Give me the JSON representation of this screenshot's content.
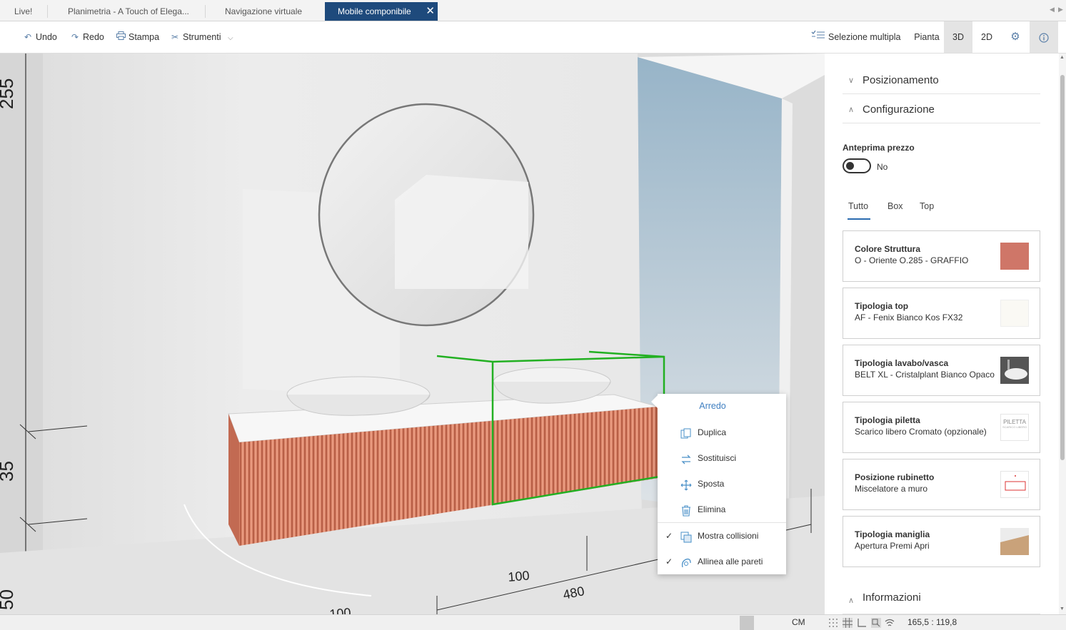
{
  "tabs": [
    {
      "label": "Live!",
      "active": false
    },
    {
      "label": "Planimetria - A Touch of Elega...",
      "active": false
    },
    {
      "label": "Navigazione virtuale",
      "active": false
    },
    {
      "label": "Mobile componibile",
      "active": true
    }
  ],
  "tab_close_glyph": "✕",
  "toolbar": {
    "undo": "Undo",
    "redo": "Redo",
    "print": "Stampa",
    "tools": "Strumenti",
    "multi_select": "Selezione multipla",
    "plan": "Pianta",
    "view3d": "3D",
    "view2d": "2D"
  },
  "viewport": {
    "dimension_labels": [
      "255",
      "35",
      "50",
      "100",
      "480",
      "100"
    ]
  },
  "context_menu": {
    "title": "Arredo",
    "items": [
      {
        "label": "Duplica",
        "icon": "duplicate-icon",
        "checked": false
      },
      {
        "label": "Sostituisci",
        "icon": "swap-icon",
        "checked": false
      },
      {
        "label": "Sposta",
        "icon": "move-icon",
        "checked": false
      },
      {
        "label": "Elimina",
        "icon": "trash-icon",
        "checked": false
      },
      {
        "label": "Mostra collisioni",
        "icon": "collision-icon",
        "checked": true
      },
      {
        "label": "Allinea alle pareti",
        "icon": "align-walls-icon",
        "checked": true
      }
    ],
    "check_glyph": "✓"
  },
  "panel": {
    "sections": {
      "positioning": "Posizionamento",
      "configuration": "Configurazione",
      "information": "Informazioni"
    },
    "price_preview": {
      "label": "Anteprima prezzo",
      "value": "No",
      "enabled": false
    },
    "subtabs": [
      {
        "label": "Tutto",
        "active": true
      },
      {
        "label": "Box",
        "active": false
      },
      {
        "label": "Top",
        "active": false
      }
    ],
    "cards": [
      {
        "title": "Colore Struttura",
        "value": "O - Oriente O.285 - GRAFFIO",
        "swatch": "#cf7668"
      },
      {
        "title": "Tipologia top",
        "value": "AF - Fenix Bianco Kos FX32",
        "swatch": "#faf9f4"
      },
      {
        "title": "Tipologia lavabo/vasca",
        "value": "BELT XL - Cristalplant Bianco Opaco",
        "swatch": "basin-thumbnail"
      },
      {
        "title": "Tipologia piletta",
        "value": "Scarico libero Cromato (opzionale)",
        "swatch": "drain-thumbnail",
        "thumb_text": "PILETTA",
        "thumb_subtext": "SCARICO LIBERO"
      },
      {
        "title": "Posizione rubinetto",
        "value": "Miscelatore a muro",
        "swatch": "faucet-thumbnail"
      },
      {
        "title": "Tipologia maniglia",
        "value": "Apertura Premi Apri",
        "swatch": "handle-thumbnail"
      }
    ]
  },
  "status": {
    "unit": "CM",
    "coords": "165,5 : 119,8"
  },
  "colors": {
    "tab_active": "#1e4a7c",
    "accent": "#3f7fc1",
    "cabinet": "#d97f66",
    "selection": "#22b022"
  }
}
